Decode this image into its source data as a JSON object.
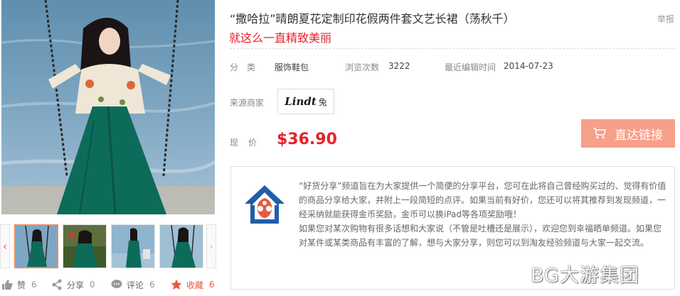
{
  "product": {
    "title": "“撒哈拉”晴朗夏花定制印花假两件套文艺长裙（荡秋千）",
    "report_label": "举报",
    "slogan": "就这么一直精致美丽",
    "meta": {
      "category_label": "分　类",
      "category_value": "服饰鞋包",
      "views_label": "浏览次数",
      "views_value": "3222",
      "edited_label": "最近编辑时间",
      "edited_value": "2014-07-23"
    },
    "source_label": "来源商家",
    "merchant_brand": "Lindt",
    "merchant_mark": "兔",
    "price_label": "现　价",
    "price_value": "$36.90",
    "go_button_label": "直达链接"
  },
  "thumbs": {
    "prev_icon": "‹",
    "next_icon": "›"
  },
  "social": {
    "like_label": "赞",
    "like_count": "6",
    "share_label": "分享",
    "share_count": "0",
    "comment_label": "评论",
    "comment_count": "6",
    "fav_label": "收藏",
    "fav_count": "6"
  },
  "info": {
    "paragraph1": "“好货分享”频道旨在为大家提供一个简便的分享平台，您可在此将自己曾经购买过的、觉得有价值的商品分享给大家，并附上一段简短的点评。如果当前有好价，您还可以将其推荐到发现频道，一经采纳就能获得金币奖励，金币可以换iPad等各项奖励哦！",
    "paragraph2": "如果您对某次购物有很多话想和大家说（不管是吐槽还是展示），欢迎您到幸福晒单频道。如果您对某件或某类商品有丰富的了解，想与大家分享，则您可以到淘友经验频道与大家一起交流。"
  },
  "watermark": "BG大游集团",
  "colors": {
    "accent_red": "#e8202a",
    "button": "#f6a08a",
    "dress_green": "#0d6b5a",
    "sea_blue": "#5f8fae"
  }
}
